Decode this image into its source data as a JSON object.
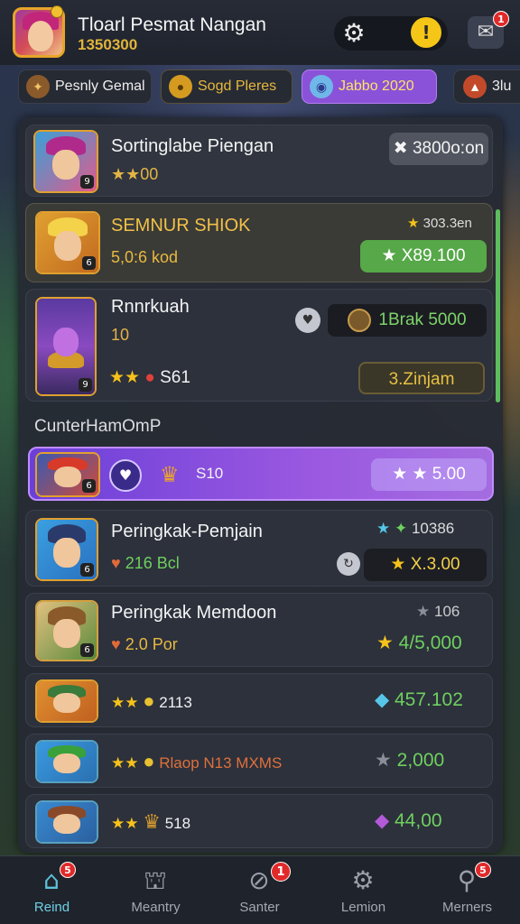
{
  "header": {
    "player_name": "Tloarl Pesmat Nangan",
    "player_score": "1350300",
    "mail_badge": "1"
  },
  "tabs": [
    {
      "label": "Pesnly Gemal"
    },
    {
      "label": "Sogd Pleres"
    },
    {
      "label": "Jabbo 2020"
    },
    {
      "label": "3lu"
    }
  ],
  "rows": [
    {
      "name": "Sortinglabe Piengan",
      "sub": "★★00",
      "reward": "✖ 3800o:on"
    },
    {
      "name": "SEMNUR SHIOK",
      "sub": "5,0:6 kod",
      "top_value": "303.3en",
      "reward": "★  X89.100"
    },
    {
      "name": "Rnnrkuah",
      "sub": "10",
      "reward": "1Brak 5000",
      "stars_text": "S61",
      "reward2": "3.Zinjam"
    },
    {
      "value": "S10",
      "reward": "★  ★ 5.00"
    },
    {
      "name": "Peringkak-Pemjain",
      "sub": "216 Bcl",
      "top_value": "10386",
      "reward": "X.3.00"
    },
    {
      "name": "Peringkak Memdoon",
      "sub": "2.0 Por",
      "top_value": "106",
      "value": "4/5,000"
    },
    {
      "value": "2113",
      "right_value": "457.102"
    },
    {
      "value": "Rlaop N13 MXMS",
      "right_value": "2,000"
    },
    {
      "value": "518",
      "right_value": "44,00"
    }
  ],
  "section_label": "CunterHamOmP",
  "nav": [
    {
      "label": "Reind",
      "icon": "home-icon",
      "badge": "5"
    },
    {
      "label": "Meantry",
      "icon": "shop-icon",
      "badge": ""
    },
    {
      "label": "Santer",
      "icon": "compass-icon",
      "badge": "1"
    },
    {
      "label": "Lemion",
      "icon": "gear-icon",
      "badge": ""
    },
    {
      "label": "Merners",
      "icon": "search-icon",
      "badge": "5"
    }
  ]
}
